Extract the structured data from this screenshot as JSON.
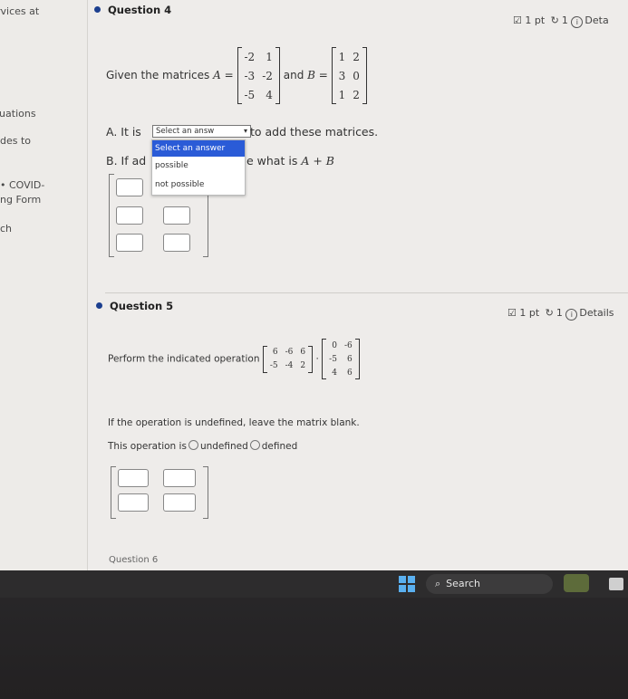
{
  "sidebar": {
    "items": [
      "rvices at",
      "luations",
      "des to",
      "COVID-",
      "ng Form",
      "ch"
    ]
  },
  "question4": {
    "title": "Question 4",
    "points": "1 pt",
    "retry": "1",
    "details": "Deta",
    "prompt_prefix": "Given the matrices",
    "matrix_a_label": "A =",
    "matrix_a": [
      [
        "-2",
        "1"
      ],
      [
        "-3",
        "-2"
      ],
      [
        "-5",
        "4"
      ]
    ],
    "and": "and",
    "matrix_b_label": "B =",
    "matrix_b": [
      [
        "1",
        "2"
      ],
      [
        "3",
        "0"
      ],
      [
        "1",
        "2"
      ]
    ],
    "partA_prefix": "A. It is",
    "select_value": "Select an answ",
    "partA_suffix": "to add these matrices.",
    "partB_prefix": "B. If ad",
    "partB_suffix": "e what is",
    "partB_math": "A + B",
    "dropdown": [
      "Select an answer",
      "possible",
      "not possible"
    ]
  },
  "question5": {
    "title": "Question 5",
    "points": "1 pt",
    "retry": "1",
    "details": "Details",
    "prompt": "Perform the indicated operation",
    "matrix_1": [
      [
        "6",
        "-6",
        "6"
      ],
      [
        "-5",
        "-4",
        "2"
      ]
    ],
    "dot": "·",
    "matrix_2": [
      [
        "0",
        "-6"
      ],
      [
        "-5",
        "6"
      ],
      [
        "4",
        "6"
      ]
    ],
    "instruction": "If the operation is undefined, leave the matrix blank.",
    "op_label": "This operation is",
    "opt_undefined": "undefined",
    "opt_defined": "defined"
  },
  "question6_partial": "Question 6",
  "taskbar": {
    "search_label": "Search"
  },
  "colors": {
    "accent": "#2a5bd7",
    "bullet": "#1c3f8f"
  }
}
